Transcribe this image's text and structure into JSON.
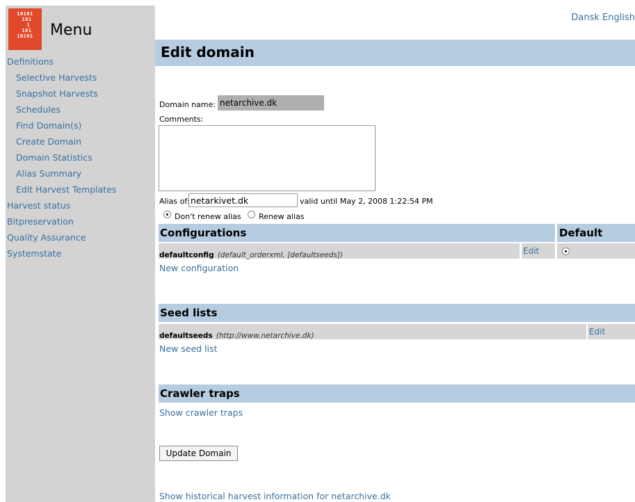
{
  "sidebar": {
    "logo_text": "10101\n 101\n  1\n 101\n10101",
    "menu_title": "Menu",
    "items": [
      {
        "label": "Definitions"
      },
      {
        "label": "Selective Harvests"
      },
      {
        "label": "Snapshot Harvests"
      },
      {
        "label": "Schedules"
      },
      {
        "label": "Find Domain(s)"
      },
      {
        "label": "Create Domain"
      },
      {
        "label": "Domain Statistics"
      },
      {
        "label": "Alias Summary"
      },
      {
        "label": "Edit Harvest Templates"
      },
      {
        "label": "Harvest status"
      },
      {
        "label": "Bitpreservation"
      },
      {
        "label": "Quality Assurance"
      },
      {
        "label": "Systemstate"
      }
    ]
  },
  "language": {
    "dansk": "Dansk",
    "english": "English"
  },
  "page": {
    "title": "Edit domain"
  },
  "form": {
    "domain_name_label": "Domain name:",
    "domain_name_value": "netarchive.dk",
    "comments_label": "Comments:",
    "comments_value": "",
    "alias_label": "Alias of:",
    "alias_value": "netarkivet.dk",
    "valid_until": "valid until May 2, 2008 1:22:54 PM",
    "dont_renew_label": "Don't renew alias",
    "renew_label": "Renew alias",
    "selected_renew_option": "dont_renew"
  },
  "configurations": {
    "header": "Configurations",
    "default_header": "Default",
    "rows": [
      {
        "name": "defaultconfig",
        "detail": "(default_orderxml, [defaultseeds])",
        "edit_label": "Edit",
        "is_default": true
      }
    ],
    "new_link": "New configuration"
  },
  "seedlists": {
    "header": "Seed lists",
    "rows": [
      {
        "name": "defaultseeds",
        "detail": "(http://www.netarchive.dk)",
        "edit_label": "Edit"
      }
    ],
    "new_link": "New seed list"
  },
  "crawler_traps": {
    "header": "Crawler traps",
    "show_link": "Show crawler traps"
  },
  "update_button": "Update Domain",
  "history_link": "Show historical harvest information for netarchive.dk",
  "colors": {
    "sidebar_bg": "#d3d3d3",
    "header_band": "#b6cce0",
    "row_bg": "#d6d6d6",
    "link": "#3b6f9e",
    "logo": "#e04a2a"
  }
}
